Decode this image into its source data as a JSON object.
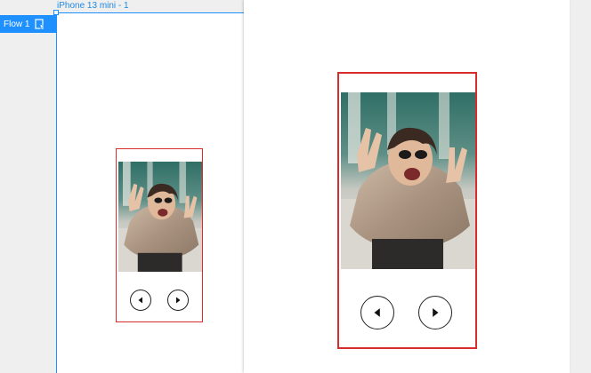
{
  "flow": {
    "label": "Flow 1",
    "icon": "play-flow-icon"
  },
  "frame": {
    "name": "iPhone 13 mini - 1"
  },
  "cards": [
    {
      "photo_alt": "Smiling woman with sunglasses making peace signs",
      "prev_icon": "arrow-left-icon",
      "next_icon": "arrow-right-icon"
    },
    {
      "photo_alt": "Smiling woman with sunglasses making peace signs",
      "prev_icon": "arrow-left-icon",
      "next_icon": "arrow-right-icon"
    }
  ],
  "colors": {
    "selection": "#1e90ff",
    "card_border": "#d92c2c",
    "canvas": "#efefef"
  }
}
